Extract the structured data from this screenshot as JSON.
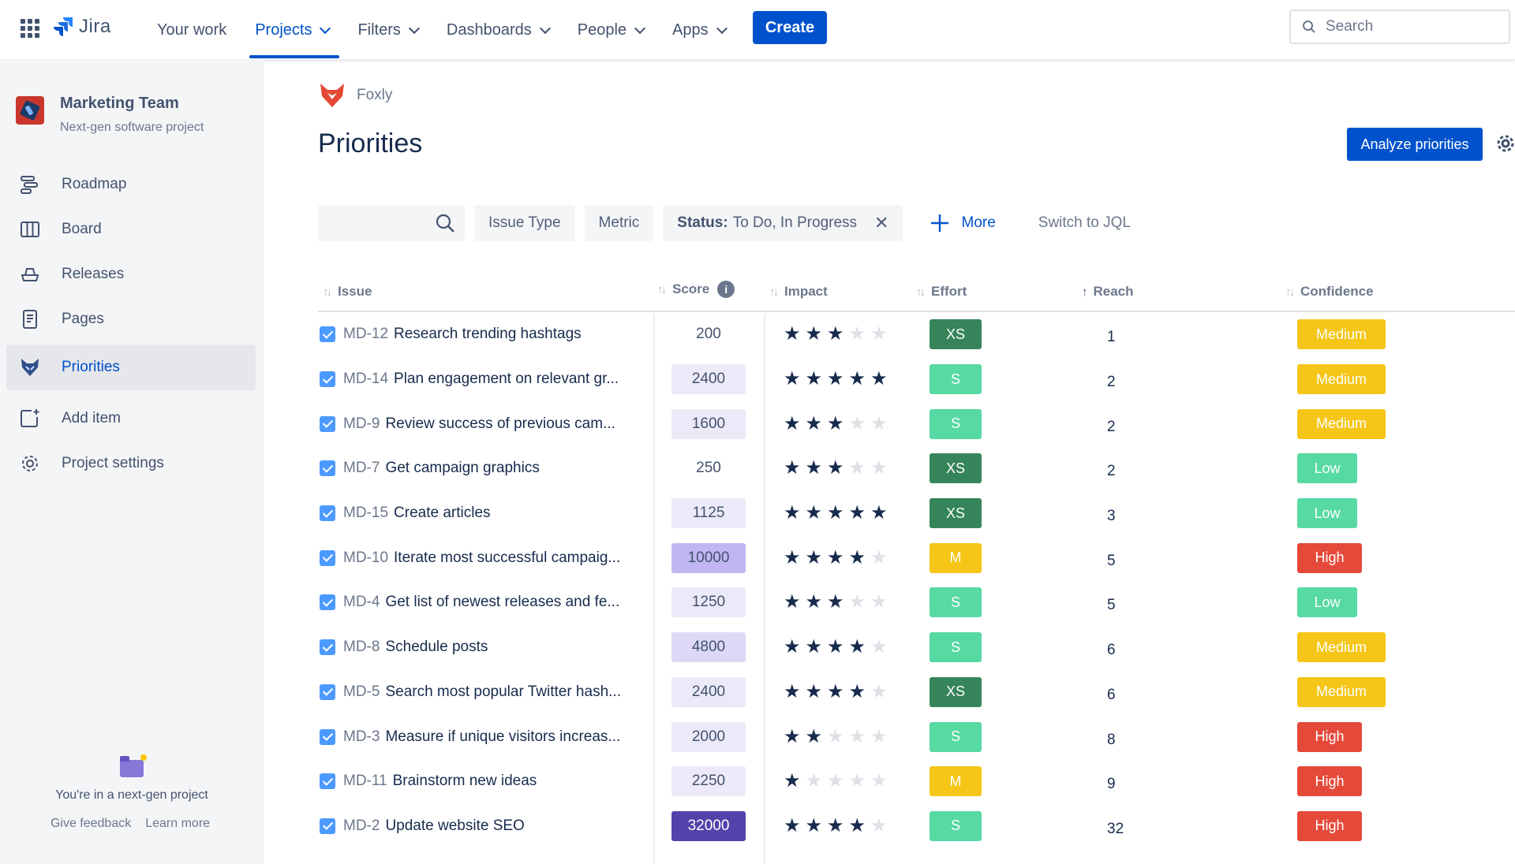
{
  "topnav": {
    "logo": "Jira",
    "items": [
      {
        "label": "Your work"
      },
      {
        "label": "Projects"
      },
      {
        "label": "Filters"
      },
      {
        "label": "Dashboards"
      },
      {
        "label": "People"
      },
      {
        "label": "Apps"
      }
    ],
    "create_label": "Create",
    "search_placeholder": "Search"
  },
  "sidebar": {
    "project_name": "Marketing Team",
    "project_type": "Next-gen software project",
    "items": [
      {
        "label": "Roadmap",
        "icon": "roadmap-icon"
      },
      {
        "label": "Board",
        "icon": "board-icon"
      },
      {
        "label": "Releases",
        "icon": "releases-icon"
      },
      {
        "label": "Pages",
        "icon": "pages-icon"
      },
      {
        "label": "Priorities",
        "icon": "priorities-icon"
      },
      {
        "label": "Add item",
        "icon": "add-item-icon"
      },
      {
        "label": "Project settings",
        "icon": "gear-icon"
      }
    ],
    "footer_text": "You're in a next-gen project",
    "feedback_link": "Give feedback",
    "learn_link": "Learn more"
  },
  "main": {
    "breadcrumb": "Foxly",
    "title": "Priorities",
    "analyze_label": "Analyze priorities",
    "filters": {
      "issue_type": "Issue Type",
      "metric": "Metric",
      "status_label": "Status:",
      "status_value": "To Do, In Progress",
      "more": "More",
      "jql": "Switch to JQL"
    },
    "columns": {
      "issue": "Issue",
      "score": "Score",
      "impact": "Impact",
      "effort": "Effort",
      "reach": "Reach",
      "confidence": "Confidence"
    }
  },
  "colors": {
    "accent": "#0052cc",
    "effort_xs": "#36855a",
    "effort_s": "#57d9a3",
    "effort_m": "#f5c518",
    "conf_medium": "#f5c518",
    "conf_low": "#57d9a3",
    "conf_high": "#e5493a"
  },
  "rows": [
    {
      "key": "MD-12",
      "summary": "Research trending hashtags",
      "score": "200",
      "impact": 3,
      "effort": "XS",
      "reach": "1",
      "confidence": "Medium"
    },
    {
      "key": "MD-14",
      "summary": "Plan engagement on relevant gr...",
      "score": "2400",
      "impact": 5,
      "effort": "S",
      "reach": "2",
      "confidence": "Medium"
    },
    {
      "key": "MD-9",
      "summary": "Review success of previous cam...",
      "score": "1600",
      "impact": 3,
      "effort": "S",
      "reach": "2",
      "confidence": "Medium"
    },
    {
      "key": "MD-7",
      "summary": "Get campaign graphics",
      "score": "250",
      "impact": 3,
      "effort": "XS",
      "reach": "2",
      "confidence": "Low"
    },
    {
      "key": "MD-15",
      "summary": "Create articles",
      "score": "1125",
      "impact": 5,
      "effort": "XS",
      "reach": "3",
      "confidence": "Low"
    },
    {
      "key": "MD-10",
      "summary": "Iterate most successful campaig...",
      "score": "10000",
      "impact": 4,
      "effort": "M",
      "reach": "5",
      "confidence": "High"
    },
    {
      "key": "MD-4",
      "summary": "Get list of newest releases and fe...",
      "score": "1250",
      "impact": 3,
      "effort": "S",
      "reach": "5",
      "confidence": "Low"
    },
    {
      "key": "MD-8",
      "summary": "Schedule posts",
      "score": "4800",
      "impact": 4,
      "effort": "S",
      "reach": "6",
      "confidence": "Medium"
    },
    {
      "key": "MD-5",
      "summary": "Search most popular Twitter hash...",
      "score": "2400",
      "impact": 4,
      "effort": "XS",
      "reach": "6",
      "confidence": "Medium"
    },
    {
      "key": "MD-3",
      "summary": "Measure if unique visitors increas...",
      "score": "2000",
      "impact": 2,
      "effort": "S",
      "reach": "8",
      "confidence": "High"
    },
    {
      "key": "MD-11",
      "summary": "Brainstorm new ideas",
      "score": "2250",
      "impact": 1,
      "effort": "M",
      "reach": "9",
      "confidence": "High"
    },
    {
      "key": "MD-2",
      "summary": "Update website SEO",
      "score": "32000",
      "impact": 4,
      "effort": "S",
      "reach": "32",
      "confidence": "High"
    }
  ]
}
